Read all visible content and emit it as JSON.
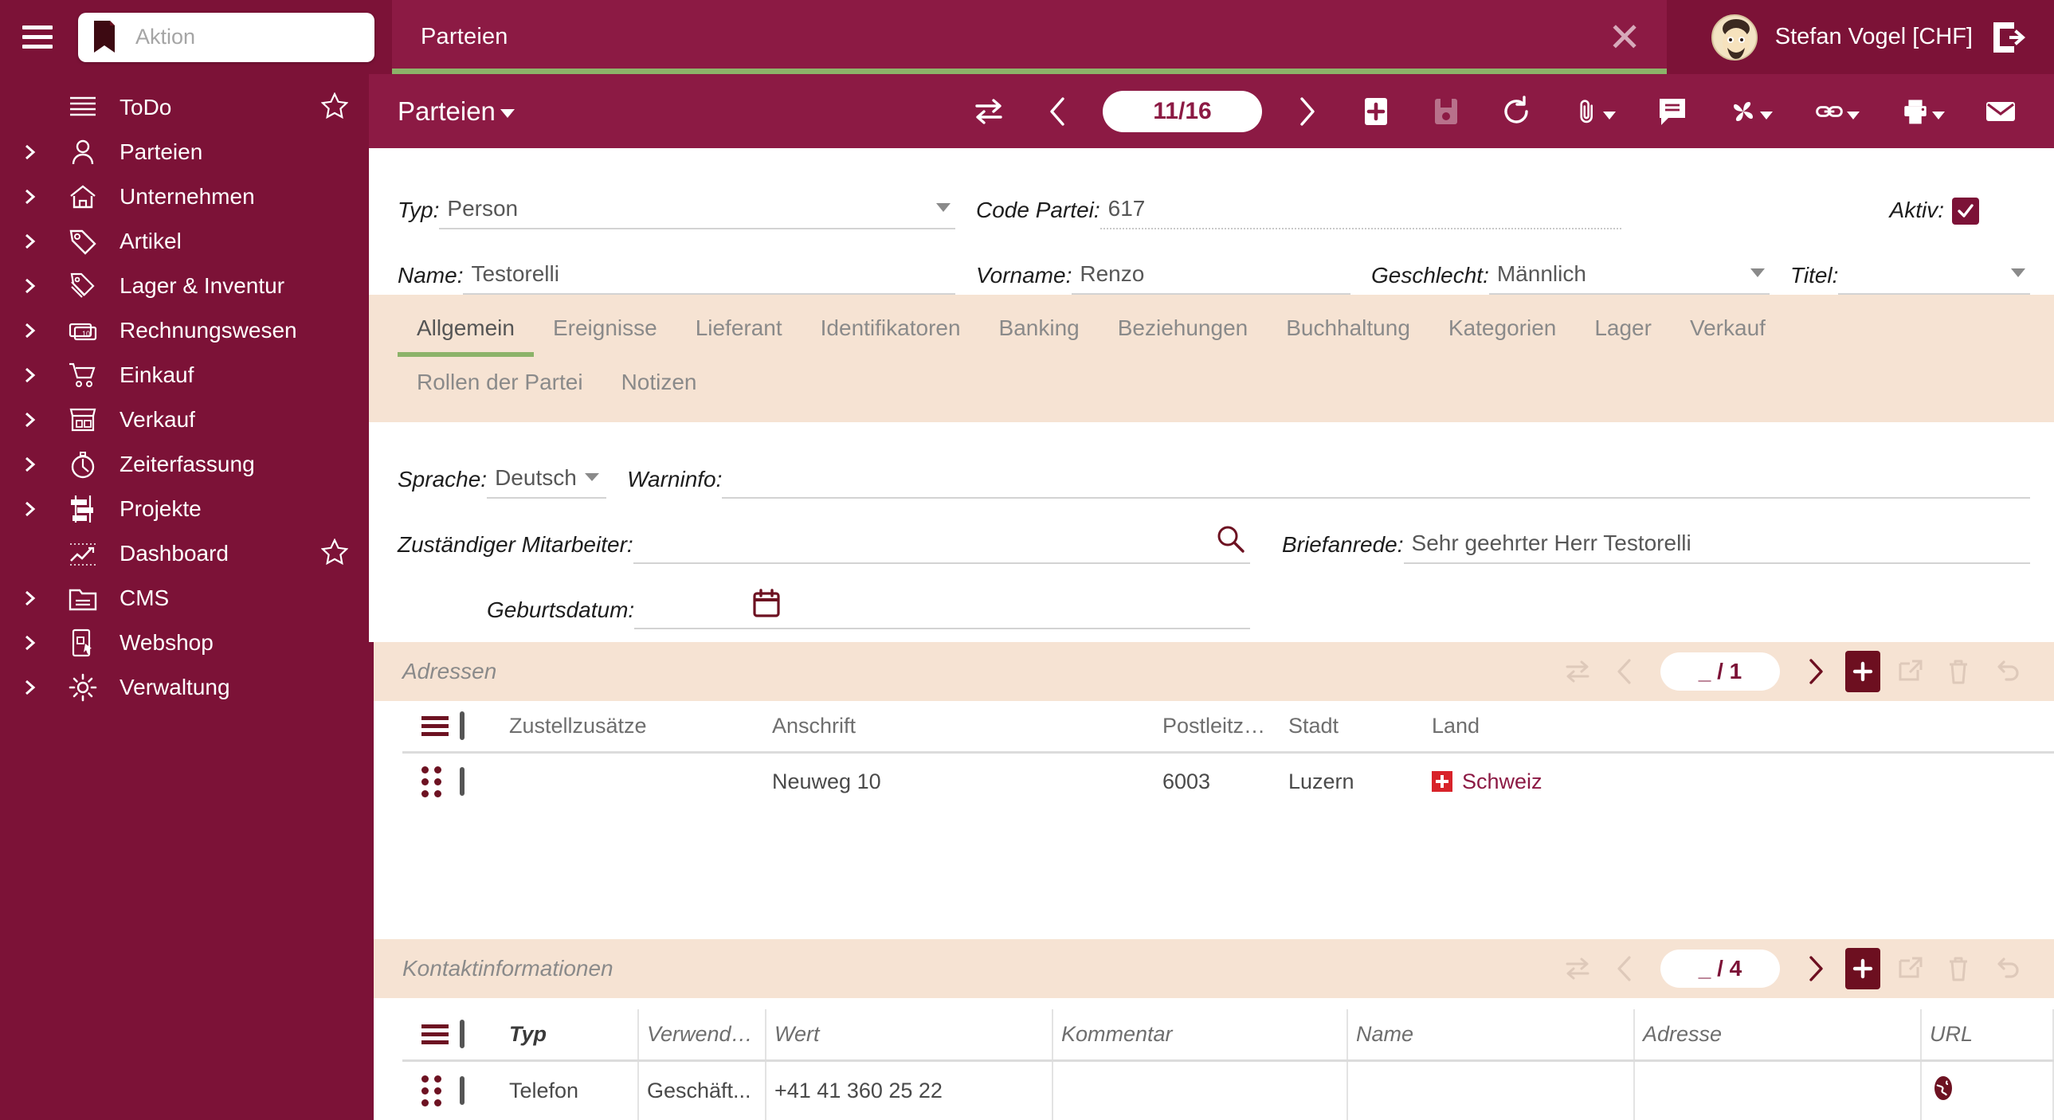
{
  "topbar": {
    "action_placeholder": "Aktion",
    "document_tab_title": "Parteien",
    "user_name": "Stefan Vogel [CHF]"
  },
  "sidebar": {
    "items": [
      {
        "label": "ToDo",
        "icon": "list-icon",
        "expandable": false,
        "starred": true
      },
      {
        "label": "Parteien",
        "icon": "person-icon",
        "expandable": true,
        "starred": false
      },
      {
        "label": "Unternehmen",
        "icon": "home-icon",
        "expandable": true,
        "starred": false
      },
      {
        "label": "Artikel",
        "icon": "tag-icon",
        "expandable": true,
        "starred": false
      },
      {
        "label": "Lager & Inventur",
        "icon": "tags-stack-icon",
        "expandable": true,
        "starred": false
      },
      {
        "label": "Rechnungswesen",
        "icon": "banknotes-icon",
        "expandable": true,
        "starred": false
      },
      {
        "label": "Einkauf",
        "icon": "cart-icon",
        "expandable": true,
        "starred": false
      },
      {
        "label": "Verkauf",
        "icon": "shop-icon",
        "expandable": true,
        "starred": false
      },
      {
        "label": "Zeiterfassung",
        "icon": "stopwatch-icon",
        "expandable": true,
        "starred": false
      },
      {
        "label": "Projekte",
        "icon": "gantt-icon",
        "expandable": true,
        "starred": false
      },
      {
        "label": "Dashboard",
        "icon": "chart-icon",
        "expandable": false,
        "starred": true
      },
      {
        "label": "CMS",
        "icon": "folder-icon",
        "expandable": true,
        "starred": false
      },
      {
        "label": "Webshop",
        "icon": "webshop-icon",
        "expandable": true,
        "starred": false
      },
      {
        "label": "Verwaltung",
        "icon": "gear-icon",
        "expandable": true,
        "starred": false
      }
    ]
  },
  "toolbar": {
    "title": "Parteien",
    "record_counter": "11/16"
  },
  "form": {
    "typ_label": "Typ:",
    "typ_value": "Person",
    "code_partei_label": "Code Partei:",
    "code_partei_value": "617",
    "aktiv_label": "Aktiv:",
    "aktiv_checked": true,
    "name_label": "Name:",
    "name_value": "Testorelli",
    "vorname_label": "Vorname:",
    "vorname_value": "Renzo",
    "geschlecht_label": "Geschlecht:",
    "geschlecht_value": "Männlich",
    "titel_label": "Titel:",
    "titel_value": ""
  },
  "tabs": {
    "row1": [
      {
        "label": "Allgemein",
        "active": true
      },
      {
        "label": "Ereignisse",
        "active": false
      },
      {
        "label": "Lieferant",
        "active": false
      },
      {
        "label": "Identifikatoren",
        "active": false
      },
      {
        "label": "Banking",
        "active": false
      },
      {
        "label": "Beziehungen",
        "active": false
      },
      {
        "label": "Buchhaltung",
        "active": false
      },
      {
        "label": "Kategorien",
        "active": false
      },
      {
        "label": "Lager",
        "active": false
      },
      {
        "label": "Verkauf",
        "active": false
      }
    ],
    "row2": [
      {
        "label": "Rollen der Partei",
        "active": false
      },
      {
        "label": "Notizen",
        "active": false
      }
    ]
  },
  "general": {
    "sprache_label": "Sprache:",
    "sprache_value": "Deutsch",
    "warninfo_label": "Warninfo:",
    "warninfo_value": "",
    "mitarbeiter_label": "Zuständiger Mitarbeiter:",
    "mitarbeiter_value": "",
    "briefanrede_label": "Briefanrede:",
    "briefanrede_value": "Sehr geehrter Herr Testorelli",
    "geburtsdatum_label": "Geburtsdatum:",
    "geburtsdatum_value": ""
  },
  "adressen": {
    "section_title": "Adressen",
    "counter": "_ / 1",
    "columns": [
      "Zustellzusätze",
      "Anschrift",
      "Postleitzahl",
      "Stadt",
      "Land"
    ],
    "rows": [
      {
        "zustellzusaetze": "",
        "anschrift": "Neuweg 10",
        "plz": "6003",
        "stadt": "Luzern",
        "land": "Schweiz"
      }
    ]
  },
  "kontaktinformationen": {
    "section_title": "Kontaktinformationen",
    "counter": "_ / 4",
    "columns": [
      "Typ",
      "Verwendu...",
      "Wert",
      "Kommentar",
      "Name",
      "Adresse",
      "URL"
    ],
    "rows": [
      {
        "typ": "Telefon",
        "verwendung": "Geschäft...",
        "wert": "+41 41 360 25 22",
        "kommentar": "",
        "name": "",
        "adresse": "",
        "url_icon": "globe-icon"
      }
    ]
  },
  "colors": {
    "brand_dark": "#7c1237",
    "brand": "#8c1a44",
    "accent_green": "#8cb369",
    "section_bg": "#f6e3d3"
  }
}
